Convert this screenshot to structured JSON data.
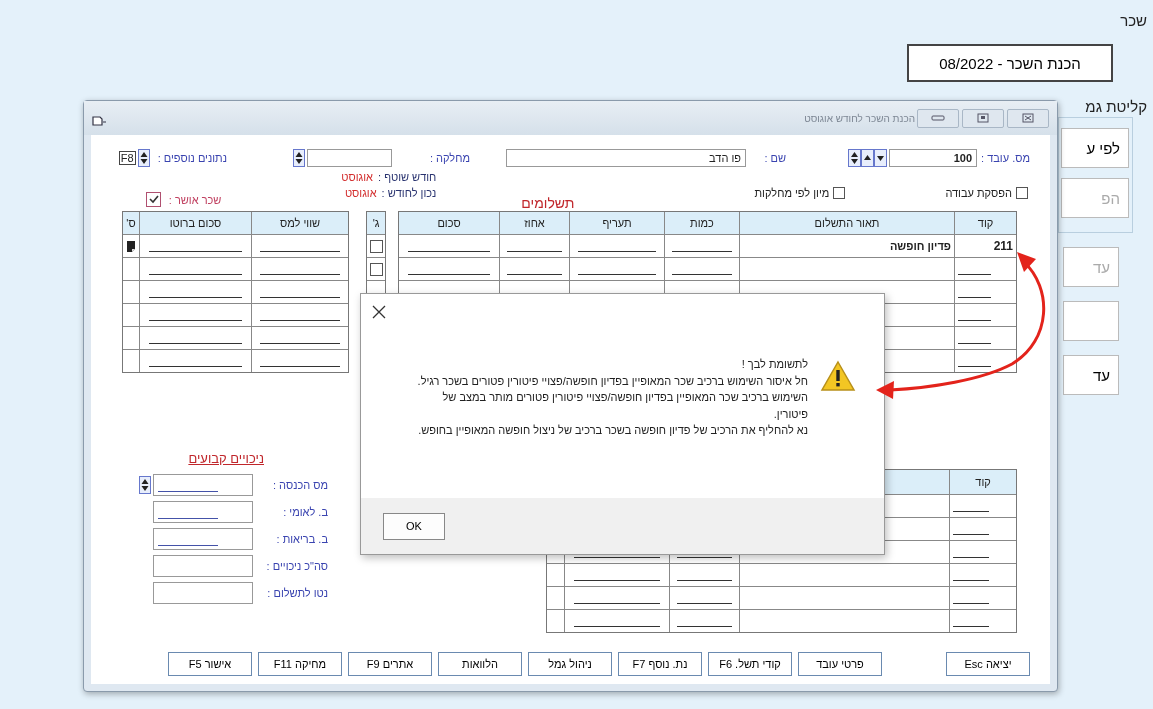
{
  "desktop": {
    "title": "שכר",
    "period_button": "הכנת השכר - 08/2022",
    "group_label": "קליטת גמ",
    "group_buttons": [
      {
        "label": "לפי ע",
        "disabled": false
      },
      {
        "label": "הפ",
        "disabled": true
      }
    ],
    "side_buttons": [
      {
        "label": "עד",
        "disabled": true
      },
      {
        "label": "עד",
        "disabled": false
      }
    ]
  },
  "window": {
    "title": "הכנת השכר לחודש אוגוסט",
    "employee_no_label": "מס. עובד :",
    "employee_no": "100",
    "name_label": "שם :",
    "name": "פו הדב",
    "department_label": "מחלקה :",
    "extra_label": "נתונים נוספים :",
    "extra_key": "F8",
    "checkboxes": [
      {
        "label": "הפסקת עבודה",
        "checked": false
      },
      {
        "label": "מיון לפי מחלקות",
        "checked": false
      }
    ],
    "current_month": {
      "label": "חודש שוטף :",
      "value": "אוגוסט"
    },
    "as_of_month": {
      "label": "נכון לחודש :",
      "value": "אוגוסט"
    },
    "approved": {
      "label": "שכר אושר :",
      "checked": true
    }
  },
  "payments": {
    "title": "תשלומים",
    "columns": [
      "קוד",
      "תאור התשלום",
      "כמות",
      "תעריף",
      "אחוז",
      "סכום"
    ],
    "check_column": "ג'",
    "tax_columns": [
      "שווי למס",
      "סכום ברוטו",
      "ס'"
    ],
    "rows": [
      {
        "code": "211",
        "description": "פדיון חופשה",
        "checked": false,
        "marked": true
      },
      {
        "checked": false
      },
      {},
      {},
      {},
      {}
    ]
  },
  "deductions": {
    "title": "ניכויים קבועים",
    "fields": [
      {
        "label": "מס הכנסה :",
        "kind": "spin"
      },
      {
        "label": "ב. לאומי :",
        "kind": "amount"
      },
      {
        "label": "ב. בריאות :",
        "kind": "amount"
      },
      {
        "label": "סה\"כ ניכויים :",
        "kind": "total"
      },
      {
        "label": "נטו לתשלום :",
        "kind": "total"
      }
    ]
  },
  "lower_table": {
    "columns": [
      "קוד"
    ]
  },
  "buttons": [
    "יציאה Esc",
    "פרטי עובד",
    "קודי תשל. F6",
    "נת. נוסף F7",
    "ניהול גמל",
    "הלוואות",
    "אתרים F9",
    "מחיקה F11",
    "אישור F5"
  ],
  "dialog": {
    "message": "לתשומת לבך !\nחל איסור השימוש ברכיב שכר המאופיין בפדיון חופשה/פצויי פיטורין פטורים בשכר רגיל.\nהשימוש ברכיב שכר המאופיין בפדיון חופשה/פצויי פיטורין פטורים מותר במצב של פיטורין.\nנא להחליף את הרכיב של פדיון חופשה בשכר ברכיב של ניצול חופשה המאופיין בחופש.",
    "button": "OK"
  }
}
